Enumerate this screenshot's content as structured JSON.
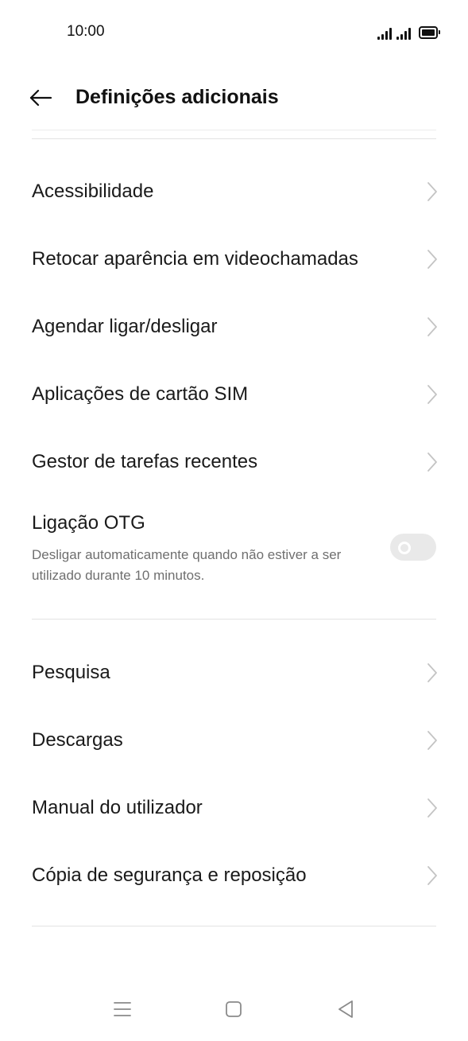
{
  "status_bar": {
    "time": "10:00",
    "icons": [
      "signal-icon",
      "signal-icon",
      "battery-icon"
    ]
  },
  "header": {
    "back_icon": "arrow-left-icon",
    "title": "Definições adicionais"
  },
  "items_group1": [
    {
      "label": "Acessibilidade"
    },
    {
      "label": "Retocar aparência em videochamadas"
    },
    {
      "label": "Agendar ligar/desligar"
    },
    {
      "label": "Aplicações de cartão SIM"
    },
    {
      "label": "Gestor de tarefas recentes"
    }
  ],
  "otg": {
    "title": "Ligação OTG",
    "description": "Desligar automaticamente quando não estiver a ser utilizado durante 10 minutos.",
    "enabled": false
  },
  "items_group2": [
    {
      "label": "Pesquisa"
    },
    {
      "label": "Descargas"
    },
    {
      "label": "Manual do utilizador"
    },
    {
      "label": "Cópia de segurança e reposição"
    }
  ],
  "nav_bar": {
    "icons": [
      "menu-icon",
      "home-icon",
      "back-triangle-icon"
    ]
  },
  "colors": {
    "text_primary": "#1a1a1a",
    "text_secondary": "#6f6f6f",
    "chevron": "#c4c4c4",
    "toggle_off": "#e9e9e9",
    "divider": "#e3e3e3"
  }
}
